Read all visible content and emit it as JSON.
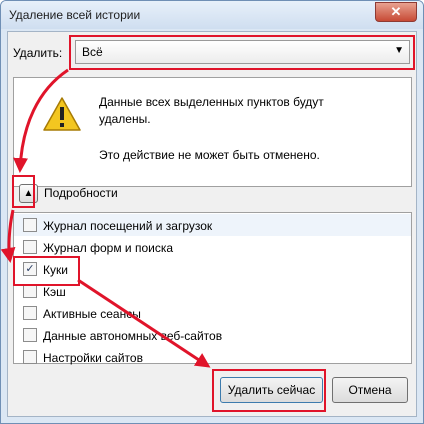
{
  "window": {
    "title": "Удаление всей истории",
    "close_label": "✕"
  },
  "range": {
    "label": "Удалить:",
    "value": "Всё"
  },
  "warning": {
    "line1": "Данные всех выделенных пунктов будут удалены.",
    "line2": "Это действие не может быть отменено."
  },
  "details": {
    "label": "Подробности"
  },
  "items": [
    {
      "label": "Журнал посещений и загрузок",
      "checked": false
    },
    {
      "label": "Журнал форм и поиска",
      "checked": false
    },
    {
      "label": "Куки",
      "checked": true
    },
    {
      "label": "Кэш",
      "checked": false
    },
    {
      "label": "Активные сеансы",
      "checked": false
    },
    {
      "label": "Данные автономных веб-сайтов",
      "checked": false
    },
    {
      "label": "Настройки сайтов",
      "checked": false
    }
  ],
  "buttons": {
    "clear_now": "Удалить сейчас",
    "cancel": "Отмена"
  },
  "colors": {
    "annotation": "#e0142a",
    "accent": "#3d7bad"
  }
}
